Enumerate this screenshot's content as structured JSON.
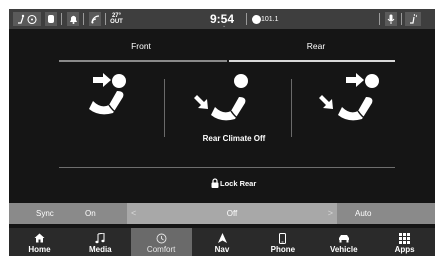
{
  "status_bar": {
    "time": "9:54",
    "radio_station": "101.1",
    "outside_temp_value": "27°",
    "outside_temp_label": "OUT"
  },
  "tabs": [
    {
      "label": "Front",
      "active": false
    },
    {
      "label": "Rear",
      "active": true
    }
  ],
  "seats": {
    "caption": "Rear Climate Off"
  },
  "lock": {
    "label": "Lock Rear"
  },
  "controls": {
    "sync_label": "Sync",
    "sync_value": "On",
    "fan_value": "Off",
    "auto_label": "Auto"
  },
  "nav": [
    {
      "label": "Home",
      "icon": "home-icon",
      "active": false
    },
    {
      "label": "Media",
      "icon": "music-note-icon",
      "active": false
    },
    {
      "label": "Comfort",
      "icon": "comfort-icon",
      "active": true
    },
    {
      "label": "Nav",
      "icon": "navigation-arrow-icon",
      "active": false
    },
    {
      "label": "Phone",
      "icon": "phone-icon",
      "active": false
    },
    {
      "label": "Vehicle",
      "icon": "car-icon",
      "active": false
    },
    {
      "label": "Apps",
      "icon": "apps-grid-icon",
      "active": false
    }
  ],
  "colors": {
    "screen_bg": "#151515",
    "status_bar_bg": "#3e3e3e",
    "strip_bg": "#8a8a8a",
    "active_nav_bg": "#6a6a6a"
  }
}
